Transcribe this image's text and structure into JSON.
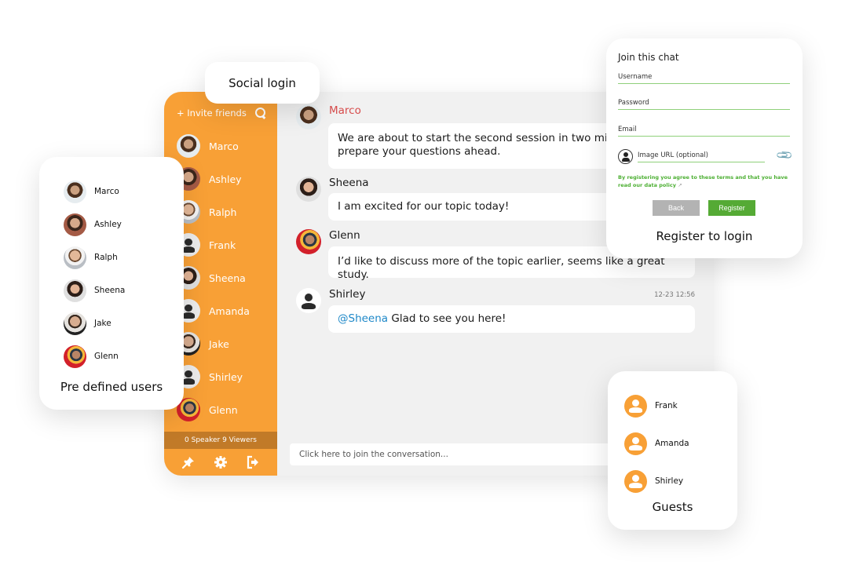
{
  "sidebar": {
    "invite_label": "+ Invite friends",
    "search_icon": "search-icon",
    "users": [
      {
        "name": "Marco",
        "avatar": "photo-marco"
      },
      {
        "name": "Ashley",
        "avatar": "photo-ashley"
      },
      {
        "name": "Ralph",
        "avatar": "photo-ralph"
      },
      {
        "name": "Frank",
        "avatar": "default-user-icon"
      },
      {
        "name": "Sheena",
        "avatar": "photo-sheena"
      },
      {
        "name": "Amanda",
        "avatar": "default-user-icon"
      },
      {
        "name": "Jake",
        "avatar": "photo-jake"
      },
      {
        "name": "Shirley",
        "avatar": "default-user-icon"
      },
      {
        "name": "Glenn",
        "avatar": "photo-glenn"
      }
    ],
    "stats": "0 Speaker 9 Viewers",
    "tools": [
      {
        "name": "pin",
        "icon": "pin-icon"
      },
      {
        "name": "settings",
        "icon": "gear-icon"
      },
      {
        "name": "logout",
        "icon": "sign-out-icon"
      }
    ],
    "color": "#f8a036"
  },
  "chat": {
    "messages": [
      {
        "author": "Marco",
        "author_color": "#d74c4c",
        "text": "We are about to start the second session in two minutes, please prepare your questions ahead.",
        "time": ""
      },
      {
        "author": "Sheena",
        "text": "I am excited for our topic today!",
        "time": ""
      },
      {
        "author": "Glenn",
        "text": "I’d like to discuss more of the topic earlier, seems like a great study.",
        "time": ""
      },
      {
        "author": "Shirley",
        "mention": "@Sheena",
        "text": " Glad to see you here!",
        "time": "12-23 12:56"
      }
    ],
    "composer_placeholder": "Click here to join the conversation..."
  },
  "social_login": {
    "label": "Social login"
  },
  "predefined_users": {
    "users": [
      "Marco",
      "Ashley",
      "Ralph",
      "Sheena",
      "Jake",
      "Glenn"
    ],
    "label": "Pre defined users"
  },
  "register": {
    "title": "Join this chat",
    "fields": {
      "username": "Username",
      "password": "Password",
      "email": "Email",
      "image_url": "Image URL (optional)"
    },
    "terms": "By registering you agree to these terms and that you have read our data policy",
    "back_label": "Back",
    "register_label": "Register",
    "caption": "Register to login",
    "accent": "#55aa35"
  },
  "guests": {
    "users": [
      "Frank",
      "Amanda",
      "Shirley"
    ],
    "label": "Guests"
  }
}
